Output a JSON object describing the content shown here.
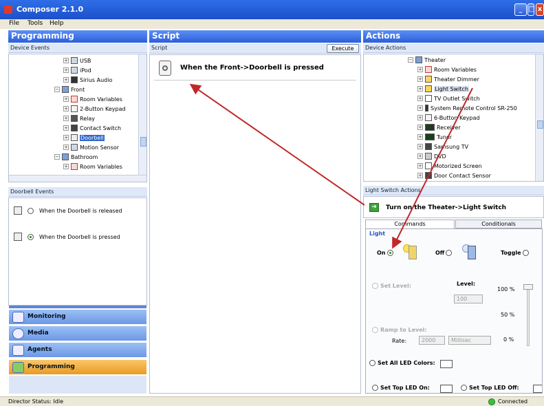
{
  "app": {
    "title": "Composer 2.1.0"
  },
  "menu": [
    "File",
    "Tools",
    "Help"
  ],
  "programming": {
    "header": "Programming",
    "device_events_label": "Device Events",
    "tree": [
      {
        "label": "USB",
        "icon": "usb-icon"
      },
      {
        "label": "iPod",
        "icon": "ipod-icon"
      },
      {
        "label": "Sirius Audio",
        "icon": "sirius-icon"
      },
      {
        "label": "Front",
        "icon": "room-icon"
      },
      {
        "label": "Room Variables",
        "icon": "room-variables-icon"
      },
      {
        "label": "2-Button Keypad",
        "icon": "keypad-icon"
      },
      {
        "label": "Relay",
        "icon": "relay-icon"
      },
      {
        "label": "Contact Switch",
        "icon": "contact-switch-icon"
      },
      {
        "label": "Doorbell",
        "icon": "doorbell-icon"
      },
      {
        "label": "Motion Sensor",
        "icon": "motion-sensor-icon"
      },
      {
        "label": "Bathroom",
        "icon": "room-icon"
      },
      {
        "label": "Room Variables",
        "icon": "room-variables-icon"
      }
    ],
    "events_header": "Doorbell Events",
    "events": [
      {
        "label": "When the Doorbell is released",
        "selected": false
      },
      {
        "label": "When the Doorbell is pressed",
        "selected": true
      }
    ],
    "nav": [
      "Monitoring",
      "Media",
      "Agents",
      "Programming"
    ],
    "nav_active": "Programming"
  },
  "script": {
    "header": "Script",
    "sub_label": "Script",
    "execute_label": "Execute",
    "statement": "When the Front->Doorbell is pressed"
  },
  "actions": {
    "header": "Actions",
    "device_actions_label": "Device Actions",
    "tree": [
      {
        "label": "Theater",
        "icon": "room-icon"
      },
      {
        "label": "Room Variables",
        "icon": "room-variables-icon"
      },
      {
        "label": "Theater Dimmer",
        "icon": "dimmer-icon"
      },
      {
        "label": "Light Switch",
        "icon": "light-switch-icon"
      },
      {
        "label": "TV Outlet Switch",
        "icon": "outlet-icon"
      },
      {
        "label": "System Remote Control SR-250",
        "icon": "remote-icon"
      },
      {
        "label": "6-Button Keypad",
        "icon": "keypad-icon"
      },
      {
        "label": "Receiver",
        "icon": "receiver-icon"
      },
      {
        "label": "Tuner",
        "icon": "tuner-icon"
      },
      {
        "label": "Samsung TV",
        "icon": "tv-icon"
      },
      {
        "label": "DVD",
        "icon": "dvd-icon"
      },
      {
        "label": "Motorized Screen",
        "icon": "screen-icon"
      },
      {
        "label": "Door Contact Sensor",
        "icon": "sensor-icon"
      }
    ],
    "switch_actions_header": "Light Switch Actions",
    "current_action": "Turn on the Theater->Light Switch",
    "tabs": [
      "Commands",
      "Conditionals"
    ],
    "group_label": "Light",
    "on_label": "On",
    "off_label": "Off",
    "toggle_label": "Toggle",
    "set_level_label": "Set Level:",
    "level_label": "Level:",
    "level_value": "100",
    "slider_ticks": [
      "100 %",
      "50 %",
      "0 %"
    ],
    "ramp_label": "Ramp to Level:",
    "rate_label": "Rate:",
    "rate_value": "2000",
    "rate_unit": "Millisec",
    "set_all_led": "Set All LED Colors:",
    "set_top_led_on": "Set Top LED On:",
    "set_top_led_off": "Set Top LED Off:"
  },
  "status": {
    "left": "Director Status: Idle",
    "right": "Connected"
  }
}
